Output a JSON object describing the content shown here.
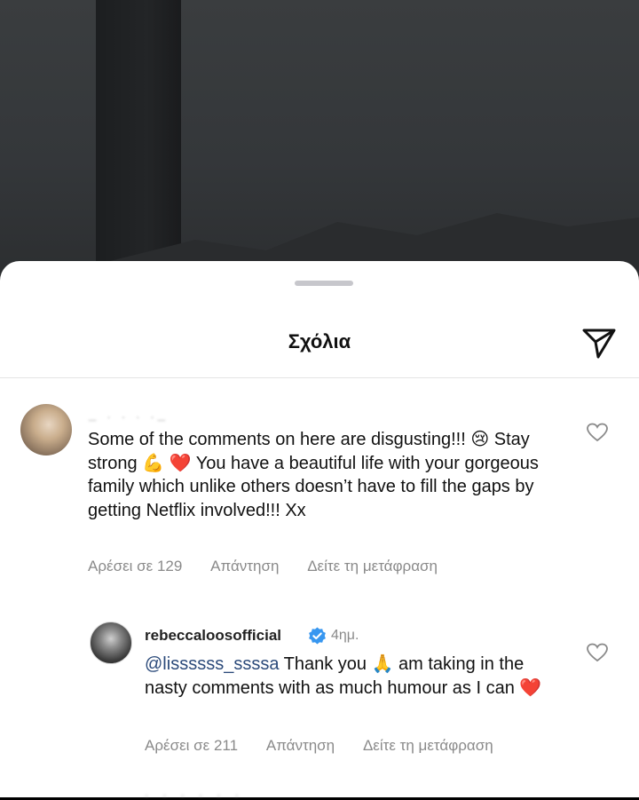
{
  "header": {
    "title": "Σχόλια",
    "send_icon": "paper-plane-icon"
  },
  "comments": [
    {
      "username": "_  .  .  .  ._",
      "text": "Some of the comments on here are disgusting!!! 😢 Stay strong 💪 ❤️ You have a beautiful life with your gorgeous family which unlike others doesn’t have to fill the gaps by getting Netflix involved!!! Xx",
      "likes": "Αρέσει σε 129",
      "reply": "Απάντηση",
      "translate": "Δείτε τη μετάφραση"
    }
  ],
  "reply": {
    "username": "rebeccaloosofficial",
    "time": "4ημ.",
    "mention": "@lissssss_ssssa",
    "text": " Thank you 🙏 am taking in the nasty comments with as much humour as I can ❤️",
    "likes": "Αρέσει σε 211",
    "reply": "Απάντηση",
    "translate": "Δείτε τη μετάφραση"
  },
  "colors": {
    "sheet": "#ffffff",
    "meta": "#8a8a8a",
    "verified": "#3897f0",
    "mention": "#2b4a7a"
  }
}
